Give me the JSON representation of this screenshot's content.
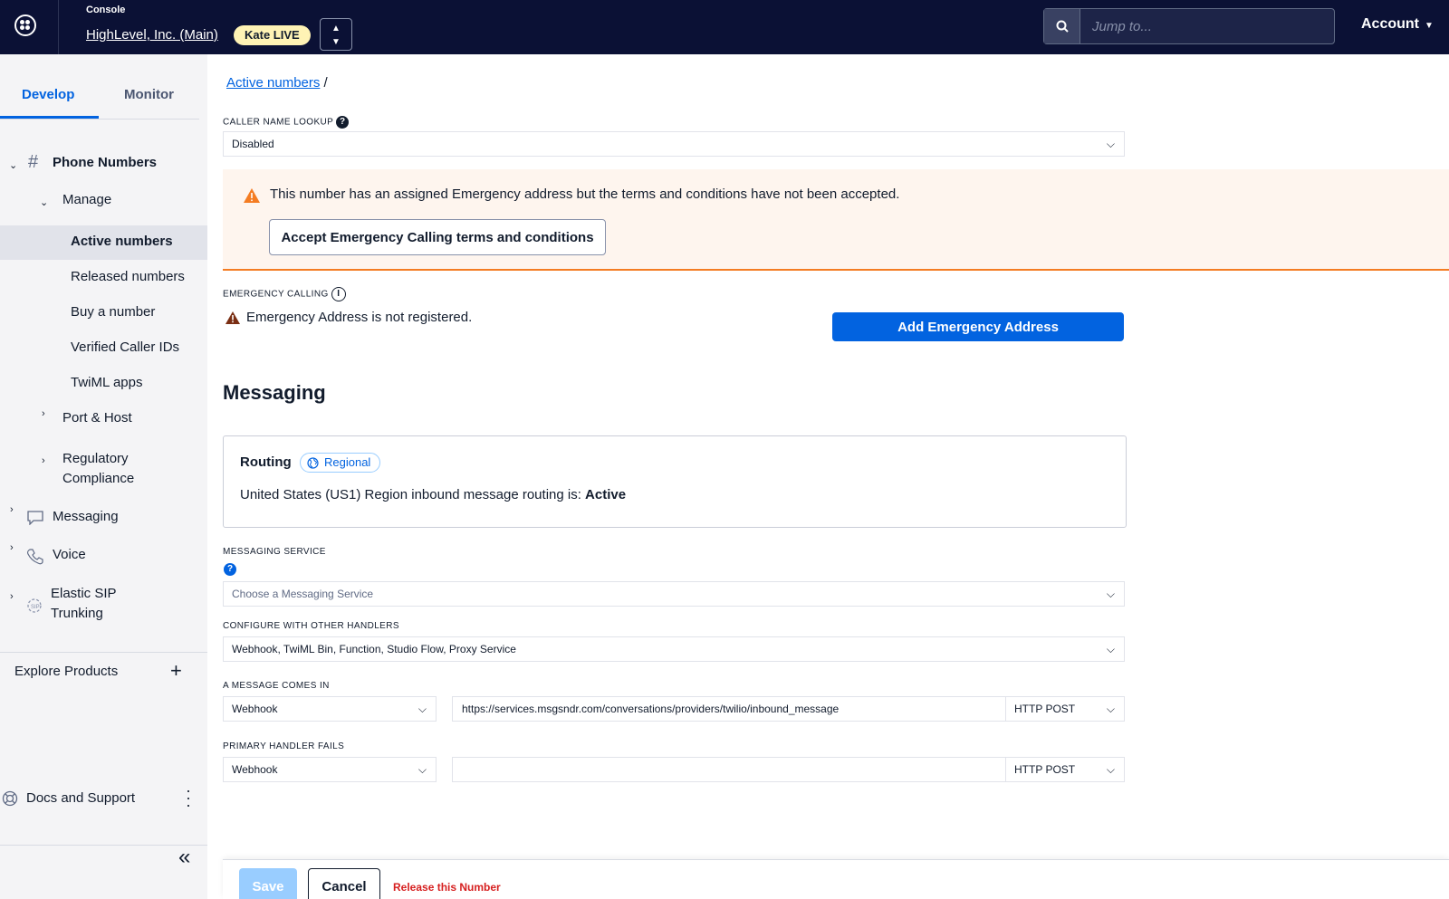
{
  "header": {
    "console_label": "Console",
    "account_name": "HighLevel, Inc. (Main)",
    "live_badge": "Kate LIVE",
    "search_placeholder": "Jump to...",
    "account_menu": "Account"
  },
  "sidebar": {
    "tabs": [
      "Develop",
      "Monitor"
    ],
    "phone_numbers": "Phone Numbers",
    "manage": "Manage",
    "manage_items": [
      "Active numbers",
      "Released numbers",
      "Buy a number",
      "Verified Caller IDs",
      "TwiML apps"
    ],
    "port_host": "Port & Host",
    "regulatory": [
      "Regulatory",
      "Compliance"
    ],
    "messaging": "Messaging",
    "voice": "Voice",
    "elastic_sip": [
      "Elastic SIP",
      "Trunking"
    ],
    "explore": "Explore Products",
    "docs": "Docs and Support"
  },
  "main": {
    "breadcrumb_link": "Active numbers",
    "breadcrumb_sep": "/",
    "caller_name_label": "CALLER NAME LOOKUP",
    "caller_name_value": "Disabled",
    "warning_text": "This number has an assigned Emergency address but the terms and conditions have not been accepted.",
    "accept_button": "Accept Emergency Calling terms and conditions",
    "emergency_label": "EMERGENCY CALLING",
    "emergency_status": "Emergency Address is not registered.",
    "add_emergency_button": "Add Emergency Address",
    "messaging_heading": "Messaging",
    "routing": {
      "title": "Routing",
      "badge": "Regional",
      "status_prefix": "United States (US1) Region inbound message routing is:",
      "status_value": "Active"
    },
    "messaging_service_label": "MESSAGING SERVICE",
    "messaging_service_placeholder": "Choose a Messaging Service",
    "other_handlers_label": "CONFIGURE WITH OTHER HANDLERS",
    "other_handlers_value": "Webhook, TwiML Bin, Function, Studio Flow, Proxy Service",
    "message_comes_in_label": "A MESSAGE COMES IN",
    "message_comes_in_type": "Webhook",
    "message_comes_in_url": "https://services.msgsndr.com/conversations/providers/twilio/inbound_message",
    "message_comes_in_method": "HTTP POST",
    "primary_fails_label": "PRIMARY HANDLER FAILS",
    "primary_fails_type": "Webhook",
    "primary_fails_url": "",
    "primary_fails_method": "HTTP POST"
  },
  "footer": {
    "save": "Save",
    "cancel": "Cancel",
    "release": "Release this Number"
  }
}
